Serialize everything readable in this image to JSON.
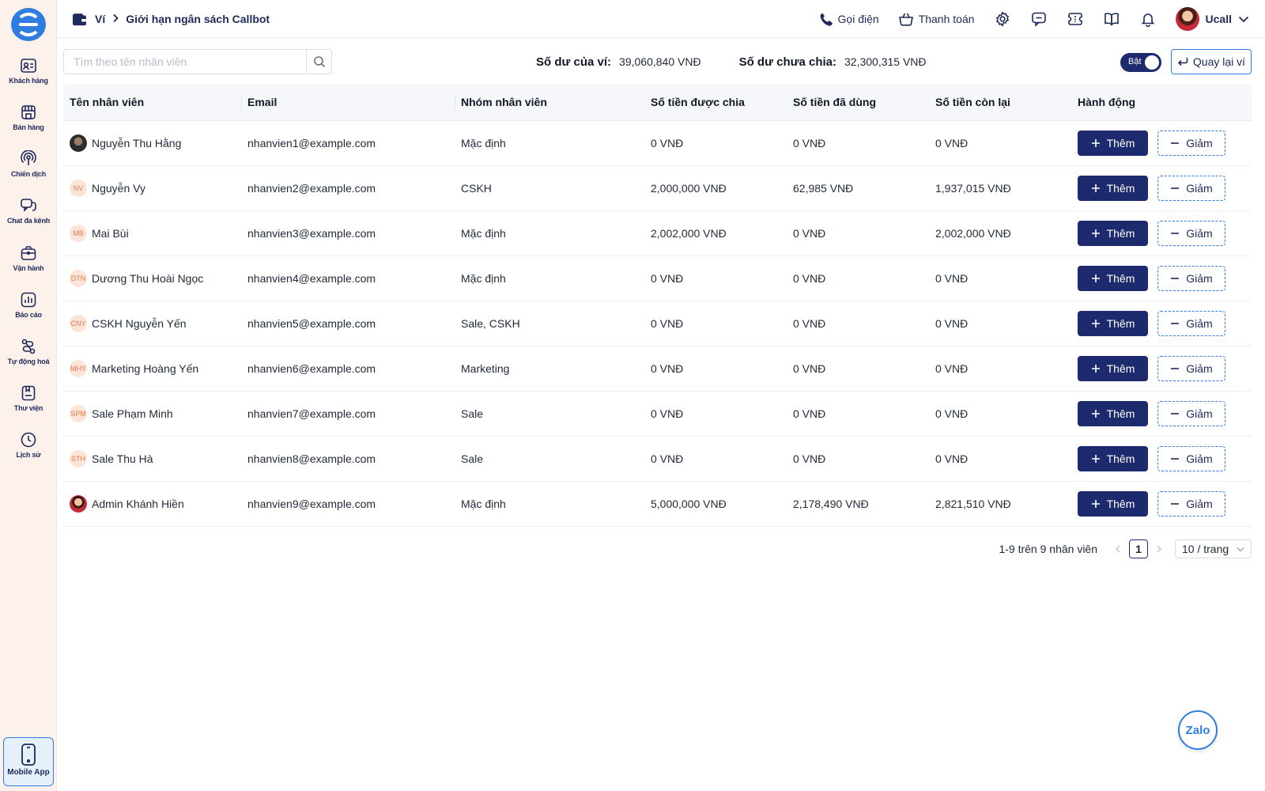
{
  "sidebar": {
    "items": [
      {
        "label": "Khách hàng",
        "icon": "contacts-icon"
      },
      {
        "label": "Bán hàng",
        "icon": "store-icon"
      },
      {
        "label": "Chiến dịch",
        "icon": "broadcast-icon"
      },
      {
        "label": "Chat đa kênh",
        "icon": "chat-icon"
      },
      {
        "label": "Vận hành",
        "icon": "briefcase-icon"
      },
      {
        "label": "Báo cáo",
        "icon": "bar-chart-icon"
      },
      {
        "label": "Tự động hoá",
        "icon": "workflow-icon"
      },
      {
        "label": "Thư viện",
        "icon": "library-icon"
      },
      {
        "label": "Lịch sử",
        "icon": "clock-icon"
      }
    ],
    "mobile_app": "Mobile App"
  },
  "header": {
    "breadcrumb_root": "Ví",
    "breadcrumb_current": "Giới hạn ngân sách Callbot",
    "call_label": "Gọi điện",
    "payment_label": "Thanh toán",
    "user_name": "Ucall"
  },
  "toolbar": {
    "search_placeholder": "Tìm theo tên nhân viên",
    "wallet_balance_label": "Số dư của ví:",
    "wallet_balance_value": "39,060,840 VNĐ",
    "unallocated_label": "Số dư chưa chia:",
    "unallocated_value": "32,300,315 VNĐ",
    "toggle_label": "Bật",
    "back_label": "Quay lại ví"
  },
  "table": {
    "columns": [
      "Tên nhân viên",
      "Email",
      "Nhóm nhân viên",
      "Số tiền được chia",
      "Số tiền đã dùng",
      "Số tiền còn lại",
      "Hành động"
    ],
    "add_label": "Thêm",
    "reduce_label": "Giảm",
    "rows": [
      {
        "initials": "",
        "name": "Nguyễn Thu Hằng",
        "email": "nhanvien1@example.com",
        "group": "Mặc định",
        "allocated": "0 VNĐ",
        "used": "0 VNĐ",
        "remaining": "0 VNĐ"
      },
      {
        "initials": "NV",
        "name": "Nguyễn Vy",
        "email": "nhanvien2@example.com",
        "group": "CSKH",
        "allocated": "2,000,000 VNĐ",
        "used": "62,985 VNĐ",
        "remaining": "1,937,015 VNĐ"
      },
      {
        "initials": "MB",
        "name": "Mai Bùi",
        "email": "nhanvien3@example.com",
        "group": "Mặc định",
        "allocated": "2,002,000 VNĐ",
        "used": "0 VNĐ",
        "remaining": "2,002,000 VNĐ"
      },
      {
        "initials": "DTN",
        "name": "Dương Thu Hoài Ngọc",
        "email": "nhanvien4@example.com",
        "group": "Mặc định",
        "allocated": "0 VNĐ",
        "used": "0 VNĐ",
        "remaining": "0 VNĐ"
      },
      {
        "initials": "CNY",
        "name": "CSKH Nguyễn Yến",
        "email": "nhanvien5@example.com",
        "group": "Sale, CSKH",
        "allocated": "0 VNĐ",
        "used": "0 VNĐ",
        "remaining": "0 VNĐ"
      },
      {
        "initials": "MHY",
        "name": "Marketing Hoàng Yến",
        "email": "nhanvien6@example.com",
        "group": "Marketing",
        "allocated": "0 VNĐ",
        "used": "0 VNĐ",
        "remaining": "0 VNĐ"
      },
      {
        "initials": "SPM",
        "name": "Sale Phạm Minh",
        "email": "nhanvien7@example.com",
        "group": "Sale",
        "allocated": "0 VNĐ",
        "used": "0 VNĐ",
        "remaining": "0 VNĐ"
      },
      {
        "initials": "STH",
        "name": "Sale Thu Hà",
        "email": "nhanvien8@example.com",
        "group": "Sale",
        "allocated": "0 VNĐ",
        "used": "0 VNĐ",
        "remaining": "0 VNĐ"
      },
      {
        "initials": "",
        "name": "Admin Khánh Hiền",
        "email": "nhanvien9@example.com",
        "group": "Mặc định",
        "allocated": "5,000,000 VNĐ",
        "used": "2,178,490 VNĐ",
        "remaining": "2,821,510 VNĐ"
      }
    ]
  },
  "pagination": {
    "summary": "1-9 trên 9 nhân viên",
    "current_page": "1",
    "page_size": "10 / trang"
  },
  "zalo_label": "Zalo",
  "colors": {
    "primary": "#1e2a6e",
    "accent": "#2f7de1",
    "sidebar_bg": "#fdf1ec"
  }
}
